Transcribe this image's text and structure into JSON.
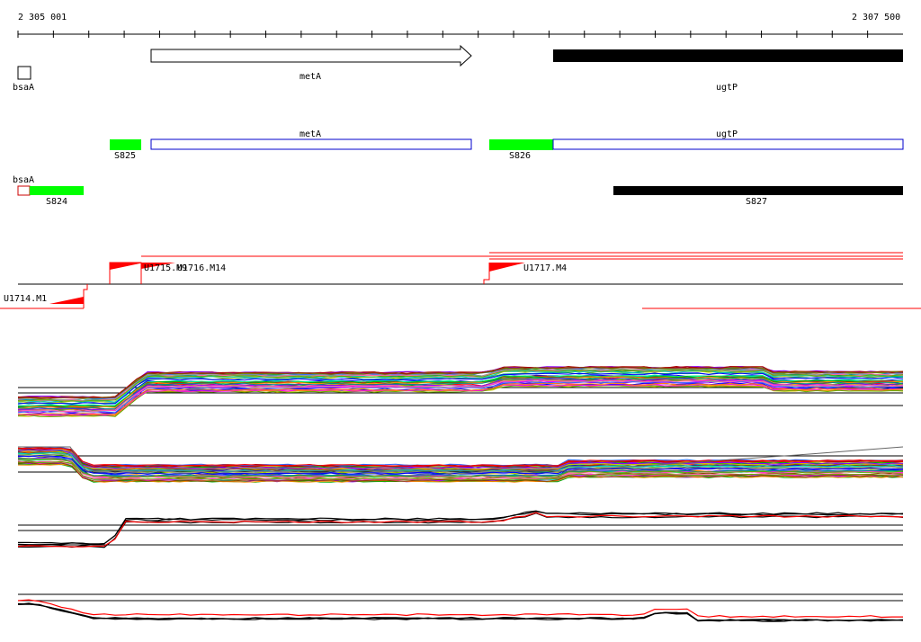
{
  "coordinates": {
    "start": "2 305 001",
    "end": "2 307 500"
  },
  "genes_row": [
    {
      "name": "bsaA",
      "type": "small-box"
    },
    {
      "name": "metA",
      "type": "arrow"
    },
    {
      "name": "ugtP",
      "type": "bar"
    }
  ],
  "segments_row": [
    {
      "label": "S825"
    },
    {
      "label": "metA"
    },
    {
      "label": "S826"
    },
    {
      "label": "ugtP"
    },
    {
      "label": "bsaA"
    },
    {
      "label": "S824"
    },
    {
      "label": "S827"
    }
  ],
  "upshifts": [
    {
      "label": "U1714.M1"
    },
    {
      "label": "U1715.M9"
    },
    {
      "label": "U1716.M14"
    },
    {
      "label": "U1717.M4"
    }
  ],
  "colors": {
    "segment": "#00ff00",
    "gene": "#000000",
    "outline_blue": "#0000cc",
    "upshift": "#ff0000"
  }
}
